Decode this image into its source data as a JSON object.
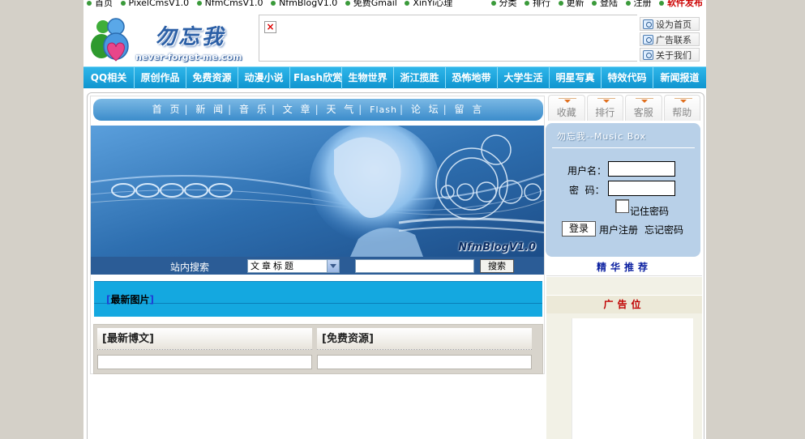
{
  "topbar": {
    "left_links": [
      "首页",
      "PixelCmsV1.0",
      "NfmCmsV1.0",
      "NfmBlogV1.0",
      "免费Gmail",
      "XinYi心理"
    ],
    "right_links": [
      "分类",
      "排行",
      "更新",
      "登陆",
      "注册"
    ],
    "hot_link": "软件发布"
  },
  "logo": {
    "cn": "勿忘我",
    "en": "never-forget-me.com"
  },
  "quick_links": [
    "设为首页",
    "广告联系",
    "关于我们"
  ],
  "nav": [
    "QQ相关",
    "原创作品",
    "免费资源",
    "动漫小说",
    "Flash欣赏",
    "生物世界",
    "浙江揽胜",
    "恐怖地带",
    "大学生活",
    "明星写真",
    "特效代码",
    "新闻报道"
  ],
  "subnav": [
    "首 页",
    "新 闻",
    "音 乐",
    "文 章",
    "天 气",
    "Flash",
    "论 坛",
    "留 言"
  ],
  "banner": {
    "tag": "NfmBlogV1.0"
  },
  "search": {
    "label": "站内搜索",
    "select_value": "文章标题",
    "input_value": "",
    "button": "搜索"
  },
  "sections": {
    "new_pics": "最新图片",
    "new_blogs": "最新博文",
    "free_res": "免费资源"
  },
  "right_tabs": [
    "收藏",
    "排行",
    "客服",
    "帮助"
  ],
  "music_box": {
    "title": "勿忘我--Music Box",
    "username_label": "用户名：",
    "password_label": "密  码：",
    "remember_label": "记住密码",
    "login_button": "登录",
    "register_link": "用户注册",
    "forgot_link": "忘记密码"
  },
  "sidebar": {
    "featured": "精华推荐",
    "ad": "广告位"
  },
  "colors": {
    "nav_blue": "#0f95cf",
    "accent_red": "#c00000",
    "featured_blue": "#0a1fa0"
  }
}
